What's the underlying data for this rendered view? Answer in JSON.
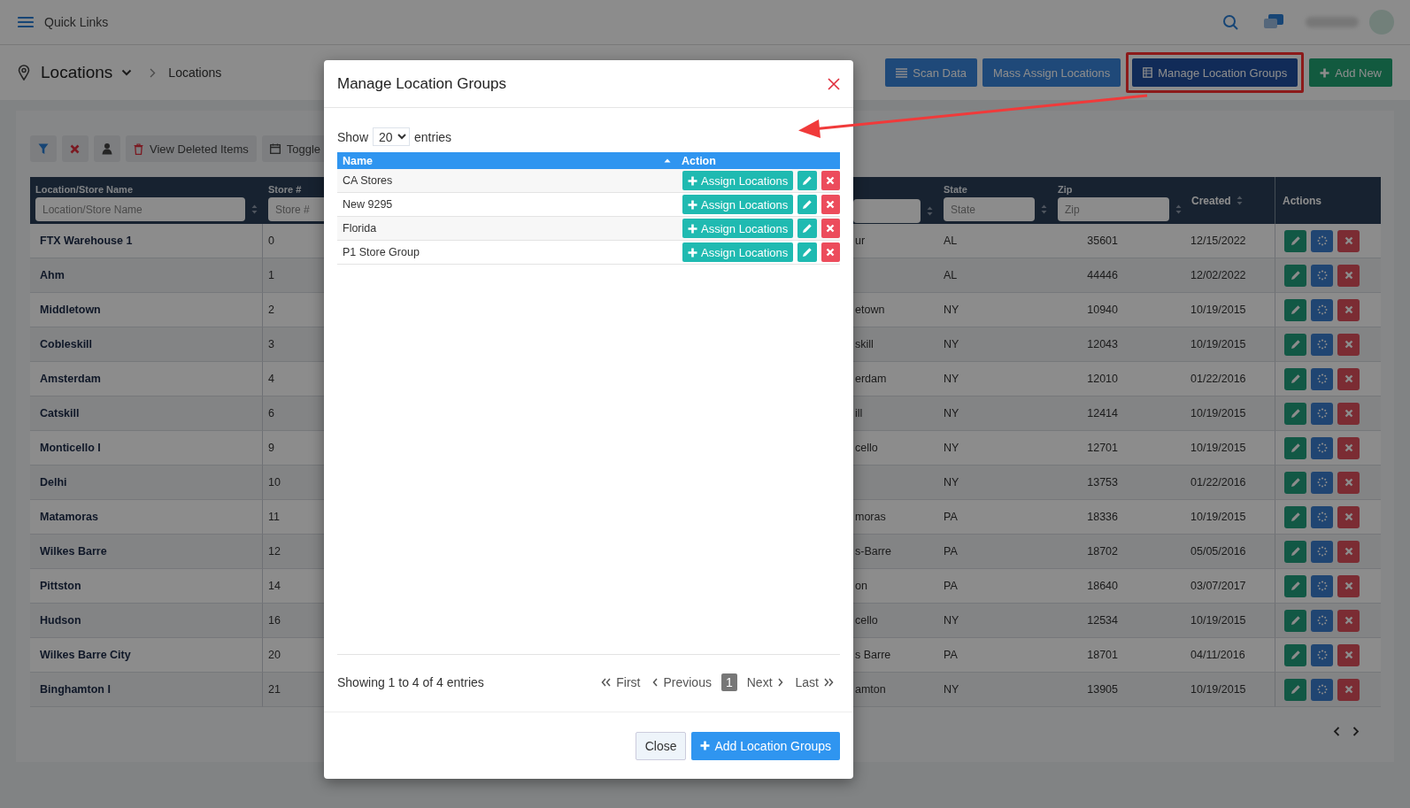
{
  "topbar": {
    "title": "Quick Links"
  },
  "breadcrumb": {
    "section": "Locations",
    "current": "Locations"
  },
  "header_buttons": [
    {
      "label": "Scan Data",
      "kind": "scan",
      "annotated": false
    },
    {
      "label": "Mass Assign Locations",
      "kind": "assign",
      "annotated": false
    },
    {
      "label": "Manage Location Groups",
      "kind": "groups",
      "annotated": true
    },
    {
      "label": "Add New",
      "kind": "add",
      "annotated": false
    }
  ],
  "toolbar": [
    {
      "kind": "filter"
    },
    {
      "kind": "clear"
    },
    {
      "kind": "user"
    },
    {
      "kind": "deleted",
      "label": "View Deleted Items"
    },
    {
      "kind": "toggle",
      "label": "Toggle"
    }
  ],
  "table": {
    "columns": [
      {
        "kind": "filter",
        "label": "Location/Store Name",
        "placeholder": "Location/Store Name"
      },
      {
        "kind": "filter",
        "label": "Store #",
        "placeholder": "Store #"
      },
      {
        "kind": "partial"
      },
      {
        "kind": "filter",
        "label": "State",
        "placeholder": "State"
      },
      {
        "kind": "filter",
        "label": "Zip",
        "placeholder": "Zip"
      },
      {
        "kind": "sort",
        "label": "Created"
      },
      {
        "kind": "plain",
        "label": "Actions"
      }
    ],
    "rows": [
      {
        "name": "FTX Warehouse 1",
        "store": "0",
        "column_3": "ur",
        "state": "AL",
        "zip": "35601",
        "created": "12/15/2022"
      },
      {
        "name": "Ahm",
        "store": "1",
        "state": "AL",
        "zip": "44446",
        "created": "12/02/2022"
      },
      {
        "name": "Middletown",
        "store": "2",
        "column_3": "etown",
        "state": "NY",
        "zip": "10940",
        "created": "10/19/2015"
      },
      {
        "name": "Cobleskill",
        "store": "3",
        "column_3": "skill",
        "state": "NY",
        "zip": "12043",
        "created": "10/19/2015"
      },
      {
        "name": "Amsterdam",
        "store": "4",
        "column_3": "erdam",
        "state": "NY",
        "zip": "12010",
        "created": "01/22/2016"
      },
      {
        "name": "Catskill",
        "store": "6",
        "column_3": "ill",
        "state": "NY",
        "zip": "12414",
        "created": "10/19/2015"
      },
      {
        "name": "Monticello I",
        "store": "9",
        "column_3": "cello",
        "state": "NY",
        "zip": "12701",
        "created": "10/19/2015"
      },
      {
        "name": "Delhi",
        "store": "10",
        "state": "NY",
        "zip": "13753",
        "created": "01/22/2016"
      },
      {
        "name": "Matamoras",
        "store": "11",
        "column_3": "moras",
        "state": "PA",
        "zip": "18336",
        "created": "10/19/2015"
      },
      {
        "name": "Wilkes Barre",
        "store": "12",
        "column_3": "s-Barre",
        "state": "PA",
        "zip": "18702",
        "created": "05/05/2016"
      },
      {
        "name": "Pittston",
        "store": "14",
        "column_3": "on",
        "state": "PA",
        "zip": "18640",
        "created": "03/07/2017"
      },
      {
        "name": "Hudson",
        "store": "16",
        "column_3": "cello",
        "state": "NY",
        "zip": "12534",
        "created": "10/19/2015"
      },
      {
        "name": "Wilkes Barre City",
        "store": "20",
        "column_3": "s Barre",
        "state": "PA",
        "zip": "18701",
        "created": "04/11/2016"
      },
      {
        "name": "Binghamton I",
        "store": "21",
        "column_3": "amton",
        "state": "NY",
        "zip": "13905",
        "created": "10/19/2015"
      }
    ]
  },
  "modal": {
    "title": "Manage Location Groups",
    "length": {
      "before": "Show",
      "value": "20",
      "after": "entries"
    },
    "columns": [
      {
        "label": "Name",
        "sorted_ascending": true
      },
      {
        "label": "Action",
        "sorted_ascending": false
      }
    ],
    "rows": [
      {
        "name": "CA Stores",
        "assign_label": "Assign Locations"
      },
      {
        "name": "New 9295",
        "assign_label": "Assign Locations"
      },
      {
        "name": "Florida",
        "assign_label": "Assign Locations"
      },
      {
        "name": "P1 Store Group",
        "assign_label": "Assign Locations"
      }
    ],
    "info": "Showing 1 to 4 of 4 entries",
    "pagination": [
      {
        "kind": "first",
        "label": "First",
        "selected": false
      },
      {
        "kind": "prev",
        "label": "Previous",
        "selected": false
      },
      {
        "kind": "page",
        "label": "1",
        "selected": true
      },
      {
        "kind": "next",
        "label": "Next",
        "selected": false
      },
      {
        "kind": "last",
        "label": "Last",
        "selected": false
      }
    ],
    "footer_buttons": [
      {
        "label": "Close",
        "kind": "secondary"
      },
      {
        "label": "Add Location Groups",
        "kind": "primary"
      }
    ]
  }
}
